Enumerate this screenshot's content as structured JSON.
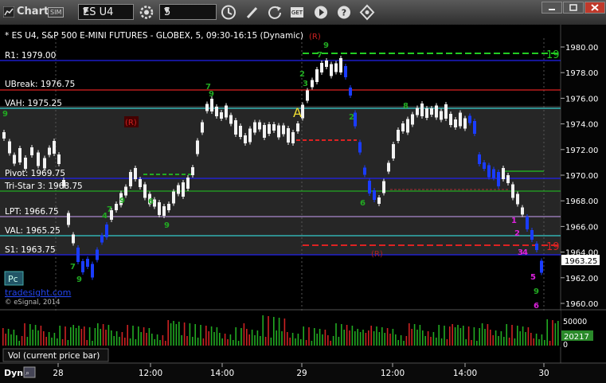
{
  "window": {
    "title": "Chart",
    "badge": "SIM",
    "symbol": "ES U4",
    "interval": "5",
    "toolbar_icons": [
      "link-icon",
      "settings-gear-icon",
      "clock-icon",
      "pencil-icon",
      "refresh-icon",
      "get-icon",
      "play-icon",
      "help-icon",
      "move-icon"
    ],
    "window_buttons": [
      "minimize-icon",
      "maximize-icon",
      "close-icon"
    ]
  },
  "chart": {
    "header": "* ES U4, S&P 500 E-MINI FUTURES - GLOBEX, 5, 09:30-16:15 (Dynamic)",
    "watermark": "tradesight.com",
    "copyright": "© eSignal, 2014",
    "pc_button": "Pc",
    "current_price": "1963.25",
    "price_ticks": [
      "1980.00",
      "1978.00",
      "1976.00",
      "1974.00",
      "1972.00",
      "1970.00",
      "1968.00",
      "1966.00",
      "1964.00",
      "1962.00",
      "1960.00"
    ],
    "time_ticks": [
      "28",
      "12:00",
      "14:00",
      "29",
      "12:00",
      "14:00",
      "30"
    ],
    "levels": [
      {
        "label": "R1: 1979.00",
        "color": "#2222ee"
      },
      {
        "label": "UBreak: 1976.75",
        "color": "#dd2222"
      },
      {
        "label": "VAH: 1975.25",
        "color": "#33cccc"
      },
      {
        "label": "Pivot: 1969.75",
        "color": "#2222ee"
      },
      {
        "label": "Tri-Star 3: 1968.75",
        "color": "#22aa22"
      },
      {
        "label": "LPT: 1966.75",
        "color": "#aa88cc"
      },
      {
        "label": "VAL: 1965.25",
        "color": "#33cccc"
      },
      {
        "label": "S1: 1963.75",
        "color": "#2222ee"
      }
    ],
    "annotations": {
      "r_marker": "(R)",
      "a_marker": "A",
      "count_19": "19",
      "markers": [
        "1",
        "2",
        "3",
        "4",
        "5",
        "6",
        "7",
        "8",
        "9"
      ]
    },
    "volume": {
      "panel_label": "Vol (current price bar)",
      "tick_top": "50000",
      "tick_bottom": "0",
      "current": "20217"
    },
    "bottom_bar": {
      "dyn": "Dyn"
    }
  }
}
